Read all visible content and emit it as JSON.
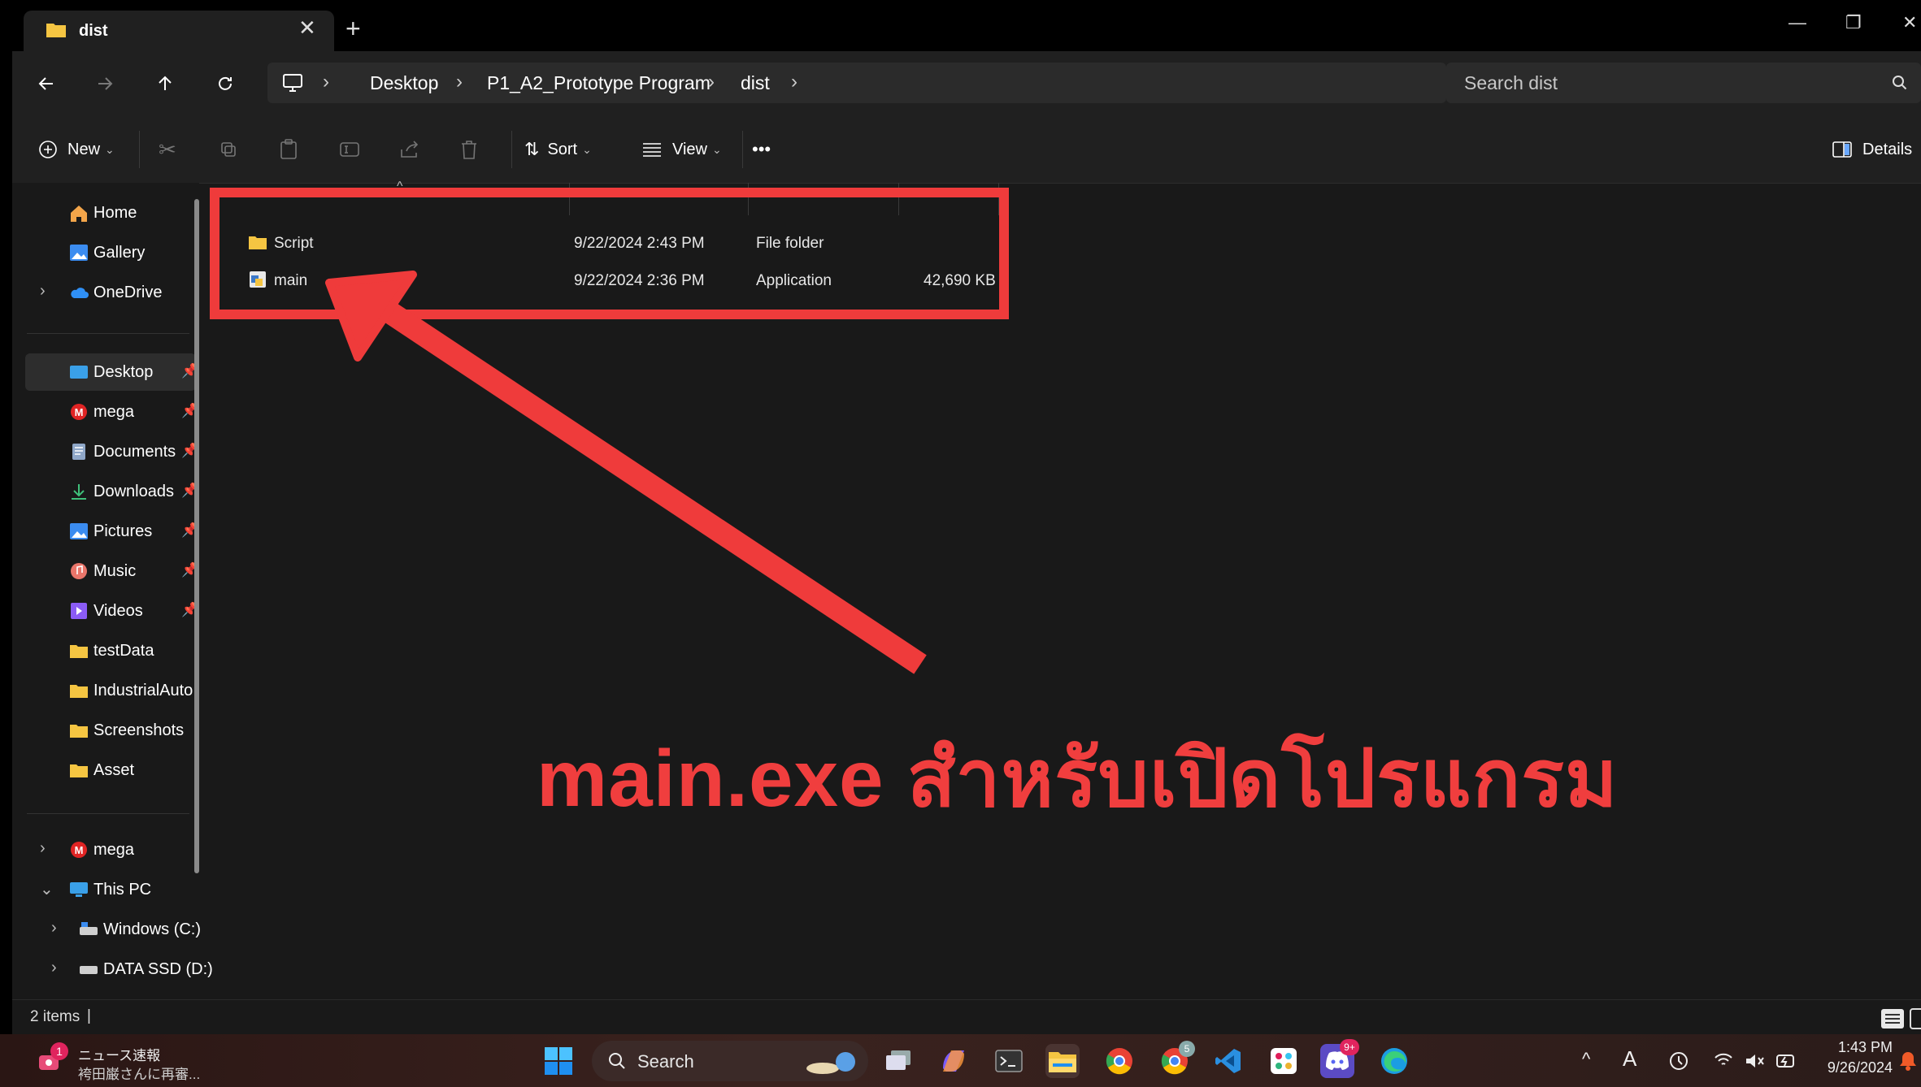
{
  "window": {
    "tab_title": "dist",
    "tab_close": "✕",
    "new_tab": "+",
    "controls": {
      "minimize": "—",
      "restore": "❐",
      "close": "✕"
    }
  },
  "navigation": {
    "breadcrumb": [
      "Desktop",
      "P1_A2_Prototype Program",
      "dist"
    ],
    "search_placeholder": "Search dist"
  },
  "toolbar": {
    "new_label": "New",
    "sort_label": "Sort",
    "view_label": "View",
    "more_label": "•••",
    "details_label": "Details"
  },
  "sidebar": {
    "quick": [
      "Home",
      "Gallery",
      "OneDrive"
    ],
    "pinned": [
      "Desktop",
      "mega",
      "Documents",
      "Downloads",
      "Pictures",
      "Music",
      "Videos",
      "testData",
      "IndustrialAuto",
      "Screenshots",
      "Asset"
    ],
    "bottom": [
      "mega",
      "This PC",
      "Windows (C:)",
      "DATA SSD (D:)"
    ]
  },
  "files": [
    {
      "name": "Script",
      "date": "9/22/2024 2:43 PM",
      "type": "File folder",
      "size": ""
    },
    {
      "name": "main",
      "date": "9/22/2024 2:36 PM",
      "type": "Application",
      "size": "42,690 KB"
    }
  ],
  "annotation": {
    "caption": "main.exe สำหรับเปิดโปรแกรม",
    "color": "#f03e3e"
  },
  "status": {
    "items": "2 items"
  },
  "taskbar": {
    "news_title": "ニュース速報",
    "news_sub": "袴田巌さんに再審...",
    "news_badge": "1",
    "search_label": "Search",
    "discord_badge": "9+",
    "chrome_badge": "5",
    "time": "1:43 PM",
    "date": "9/26/2024",
    "tray_letter": "A"
  }
}
